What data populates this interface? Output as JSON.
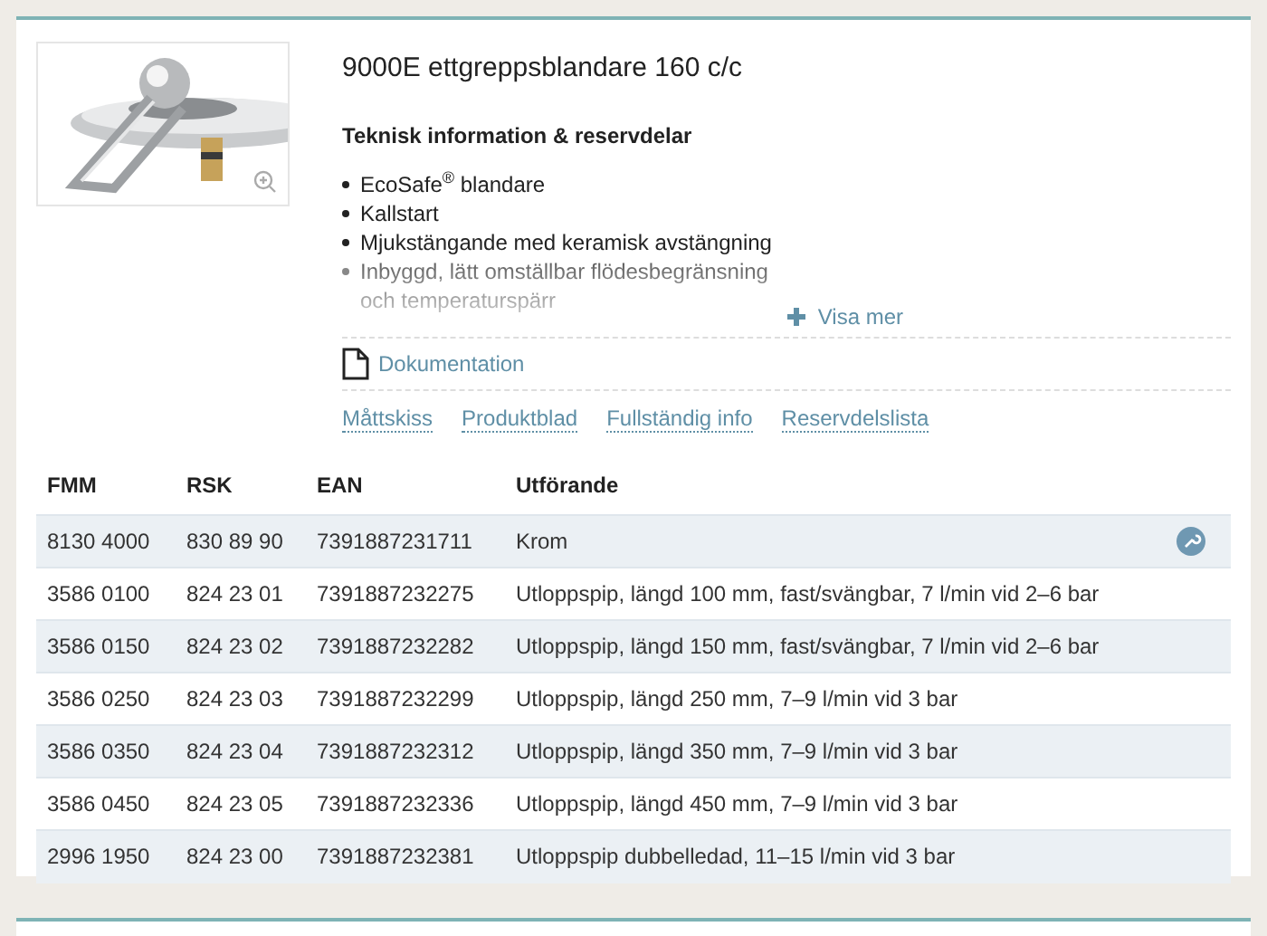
{
  "product": {
    "title": "9000E ettgreppsblandare 160 c/c",
    "section_heading": "Teknisk information & reservdelar",
    "features": [
      {
        "text": "EcoSafe$^{®}$ blandare",
        "faded": false
      },
      {
        "text": "Kallstart",
        "faded": false
      },
      {
        "text": "Mjukstängande med keramisk avstängning",
        "faded": false
      },
      {
        "text": "Inbyggd, lätt omställbar flödesbegränsning och temperaturspärr",
        "faded": true
      }
    ],
    "show_more": "Visa mer",
    "documentation": "Dokumentation",
    "links": [
      "Måttskiss",
      "Produktblad",
      "Fullständig info",
      "Reservdelslista"
    ]
  },
  "table": {
    "columns": [
      "FMM",
      "RSK",
      "EAN",
      "Utförande"
    ],
    "rows": [
      {
        "cells": [
          "8130 4000",
          "830 89 90",
          "7391887231711",
          "Krom"
        ],
        "spare_parts": true
      },
      {
        "cells": [
          "3586 0100",
          "824 23 01",
          "7391887232275",
          "Utloppspip, längd 100 mm, fast/svängbar, 7 l/min vid 2–6 bar"
        ],
        "spare_parts": false
      },
      {
        "cells": [
          "3586 0150",
          "824 23 02",
          "7391887232282",
          "Utloppspip, längd 150 mm, fast/svängbar, 7 l/min vid 2–6 bar"
        ],
        "spare_parts": false
      },
      {
        "cells": [
          "3586 0250",
          "824 23 03",
          "7391887232299",
          "Utloppspip, längd 250 mm, 7–9 l/min vid 3 bar"
        ],
        "spare_parts": false
      },
      {
        "cells": [
          "3586 0350",
          "824 23 04",
          "7391887232312",
          "Utloppspip, längd 350 mm, 7–9 l/min vid 3 bar"
        ],
        "spare_parts": false
      },
      {
        "cells": [
          "3586 0450",
          "824 23 05",
          "7391887232336",
          "Utloppspip, längd 450 mm, 7–9 l/min vid 3 bar"
        ],
        "spare_parts": false
      },
      {
        "cells": [
          "2996 1950",
          "824 23 00",
          "7391887232381",
          "Utloppspip dubbelledad, 11–15 l/min vid 3 bar"
        ],
        "spare_parts": false
      }
    ]
  }
}
